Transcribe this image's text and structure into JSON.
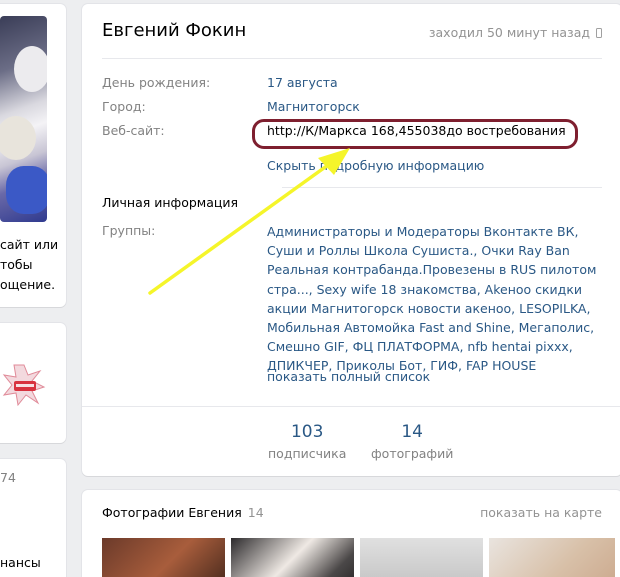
{
  "left": {
    "text_lines": [
      "сайт или",
      "тобы",
      "ощение."
    ],
    "count": "74",
    "bottom_text": "нансы"
  },
  "profile": {
    "name": "Евгений Фокин",
    "last_seen": "заходил 50 минут назад",
    "fields": [
      {
        "label": "День рождения:",
        "value": "17 августа"
      },
      {
        "label": "Город:",
        "value": "Магнитогорск"
      },
      {
        "label": "Веб-сайт:",
        "value": "http://К/Маркса 168,455038до востребования"
      }
    ],
    "hide_details": "Скрыть подробную информацию",
    "personal_section": "Личная информация",
    "groups_label": "Группы:",
    "groups_value": "Администраторы и Модераторы Вконтакте ВК, Суши и Роллы Школа Сушиста., Очки Ray Ban Реальная контрабанда.Провезены в RUS пилотом стра..., Sexy wife 18 знакомства, Akeноо скидки акции Магнитогорск новости акеноо, LESOPILKA, Мобильная Автомойка Fast and Shine, Мегаполис, Смешно GIF, ФЦ ПЛАТФОРМА, nfb hentai pixxx, ДПИКЧЕР, Приколы Бот, ГИФ, FAP HOUSE",
    "show_full_list": "показать полный список",
    "stats": [
      {
        "value": "103",
        "label": "подписчика"
      },
      {
        "value": "14",
        "label": "фотографий"
      }
    ]
  },
  "photos": {
    "title": "Фотографии Евгения",
    "count": "14",
    "map_link": "показать на карте"
  },
  "colors": {
    "link": "#2a5885",
    "muted": "#828282",
    "highlight_border": "#7e1f2f",
    "arrow": "#f5f52a"
  }
}
